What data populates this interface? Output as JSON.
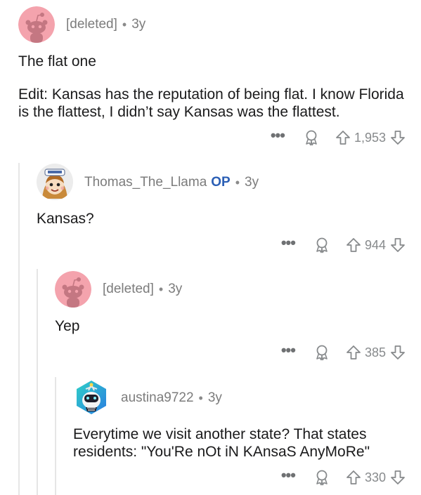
{
  "comments": [
    {
      "username": "[deleted]",
      "age": "3y",
      "paragraphs": [
        "The flat one",
        "Edit: Kansas has the reputation of being flat. I know Florida is the flattest, I didn’t say Kansas was the flattest."
      ],
      "votes": "1,953"
    },
    {
      "username": "Thomas_The_Llama",
      "badge": "OP",
      "age": "3y",
      "paragraphs": [
        "Kansas?"
      ],
      "votes": "944"
    },
    {
      "username": "[deleted]",
      "age": "3y",
      "paragraphs": [
        "Yep"
      ],
      "votes": "385"
    },
    {
      "username": "austina9722",
      "age": "3y",
      "paragraphs": [
        "Everytime we visit another state? That states residents: \"You'Re nOt iN KAnsaS AnyMoRe\""
      ],
      "votes": "330"
    }
  ],
  "icons": {
    "more": "more-options-icon",
    "award": "award-icon",
    "upvote": "upvote-arrow-icon",
    "downvote": "downvote-arrow-icon"
  },
  "colors": {
    "deleted_avatar_bg": "#f4a3ad",
    "op_badge": "#2b5fb5",
    "muted_text": "#7c7c7c",
    "thread_line": "#e6e6e6"
  }
}
